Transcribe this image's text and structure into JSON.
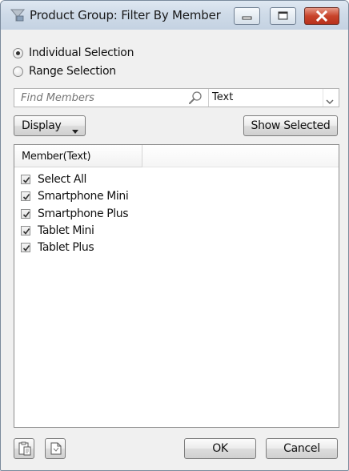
{
  "window": {
    "title": "Product Group: Filter By Member"
  },
  "selection_mode": {
    "options": [
      {
        "label": "Individual Selection",
        "selected": true
      },
      {
        "label": "Range Selection",
        "selected": false
      }
    ]
  },
  "search": {
    "placeholder": "Find Members",
    "value": "",
    "type_value": "Text"
  },
  "toolbar": {
    "display_label": "Display",
    "show_selected_label": "Show Selected"
  },
  "list": {
    "column_header": "Member(Text)",
    "items": [
      {
        "label": "Select All",
        "checked": true
      },
      {
        "label": "Smartphone Mini",
        "checked": true
      },
      {
        "label": "Smartphone Plus",
        "checked": true
      },
      {
        "label": "Tablet Mini",
        "checked": true
      },
      {
        "label": "Tablet Plus",
        "checked": true
      }
    ]
  },
  "footer": {
    "ok_label": "OK",
    "cancel_label": "Cancel",
    "icons": [
      "paste-icon",
      "copy-icon"
    ]
  },
  "colors": {
    "title_bar": "#cfdbe8",
    "close_button": "#c8442b",
    "window_bg": "#f0f0f0"
  }
}
